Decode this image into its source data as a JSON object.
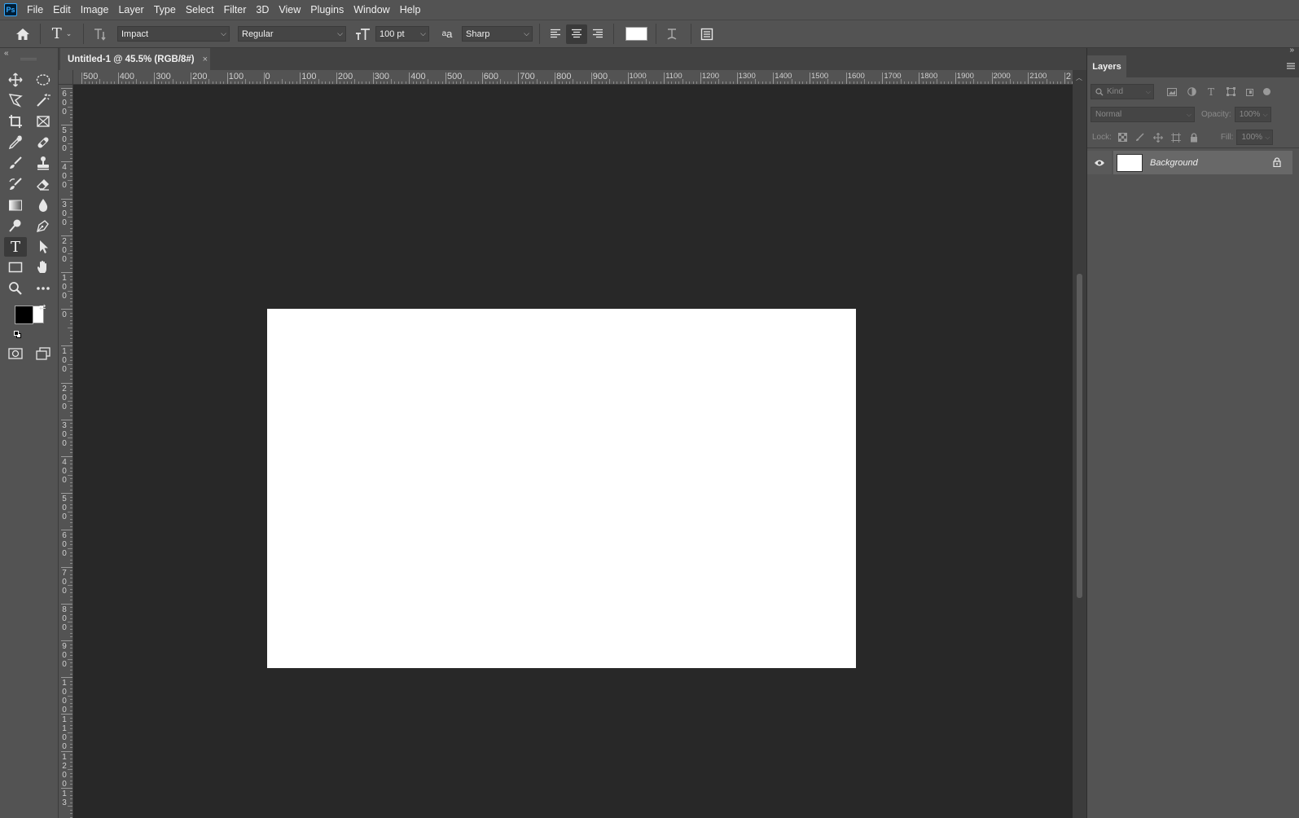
{
  "app": {
    "logo": "Ps"
  },
  "menu": [
    "File",
    "Edit",
    "Image",
    "Layer",
    "Type",
    "Select",
    "Filter",
    "3D",
    "View",
    "Plugins",
    "Window",
    "Help"
  ],
  "options": {
    "font_family": "Impact",
    "font_style": "Regular",
    "font_size": "100 pt",
    "antialias": "Sharp",
    "text_color": "#ffffff"
  },
  "document": {
    "tab_title": "Untitled-1 @ 45.5% (RGB/8#)",
    "close": "×",
    "background": "#ffffff"
  },
  "ruler": {
    "h_labels": [
      "500",
      "400",
      "300",
      "200",
      "100",
      "0",
      "100",
      "200",
      "300",
      "400",
      "500",
      "600",
      "700",
      "800",
      "900",
      "1000",
      "1100",
      "1200",
      "1300",
      "1400",
      "1500",
      "1600",
      "1700",
      "1800",
      "1900",
      "2000",
      "2100",
      "2"
    ],
    "v_labels": [
      "600",
      "500",
      "400",
      "300",
      "200",
      "100",
      "0",
      "100",
      "200",
      "300",
      "400",
      "500",
      "600",
      "700",
      "800",
      "900",
      "1000",
      "1100",
      "1200",
      "13"
    ]
  },
  "layers_panel": {
    "tab": "Layers",
    "filter_placeholder": "Kind",
    "blend_mode": "Normal",
    "opacity_label": "Opacity:",
    "opacity_value": "100%",
    "lock_label": "Lock:",
    "fill_label": "Fill:",
    "fill_value": "100%",
    "layers": [
      {
        "name": "Background",
        "visible": true,
        "locked": true
      }
    ]
  },
  "colors": {
    "foreground": "#000000",
    "background": "#ffffff"
  },
  "tools": [
    "move-icon",
    "marquee-icon",
    "lasso-icon",
    "magic-wand-icon",
    "crop-icon",
    "frame-icon",
    "eyedropper-icon",
    "healing-icon",
    "brush-icon",
    "stamp-icon",
    "history-brush-icon",
    "eraser-icon",
    "gradient-icon",
    "blur-icon",
    "dodge-icon",
    "pen-icon",
    "type-icon",
    "path-select-icon",
    "rectangle-icon",
    "hand-icon",
    "zoom-icon",
    "more-icon"
  ]
}
